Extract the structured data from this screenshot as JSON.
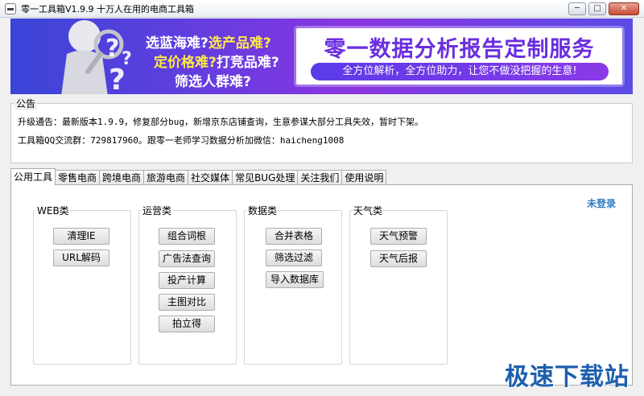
{
  "window": {
    "title": "零一工具箱V1.9.9 十万人在用的电商工具箱",
    "minimize_glyph": "─",
    "maximize_glyph": "□",
    "close_glyph": "✕"
  },
  "banner": {
    "line1_a": "选蓝海难?",
    "line1_b": "选产品难?",
    "line2_a": "定价格难?",
    "line2_b": "打竞品难?",
    "line3": "筛选人群难?",
    "card_title": "零一数据分析报告定制服务",
    "card_sub": "全方位解析，全方位助力，让您不做没把握的生意!",
    "colors": {
      "accent": "#6a2ee0",
      "highlight": "#ffe94a"
    }
  },
  "notice": {
    "legend": "公告",
    "line1": "升级通告：最新版本1.9.9，修复部分bug，新增京东店铺查询，生意参谋大部分工具失效，暂时下架。",
    "line2": "工具箱QQ交流群：729817960。跟零一老师学习数据分析加微信：haicheng1008"
  },
  "tabs": [
    {
      "label": "公用工具",
      "active": true
    },
    {
      "label": "零售电商"
    },
    {
      "label": "跨境电商"
    },
    {
      "label": "旅游电商"
    },
    {
      "label": "社交媒体"
    },
    {
      "label": "常见BUG处理"
    },
    {
      "label": "关注我们"
    },
    {
      "label": "使用说明"
    }
  ],
  "groups": {
    "web": {
      "legend": "WEB类",
      "buttons": [
        "清理IE",
        "URL解码"
      ]
    },
    "ops": {
      "legend": "运营类",
      "buttons": [
        "组合词根",
        "广告法查询",
        "投产计算",
        "主图对比",
        "拍立得"
      ]
    },
    "data": {
      "legend": "数据类",
      "buttons": [
        "合并表格",
        "筛选过滤",
        "导入数据库"
      ]
    },
    "weather": {
      "legend": "天气类",
      "buttons": [
        "天气预警",
        "天气后报"
      ]
    }
  },
  "login_status": "未登录",
  "watermark": "极速下载站"
}
